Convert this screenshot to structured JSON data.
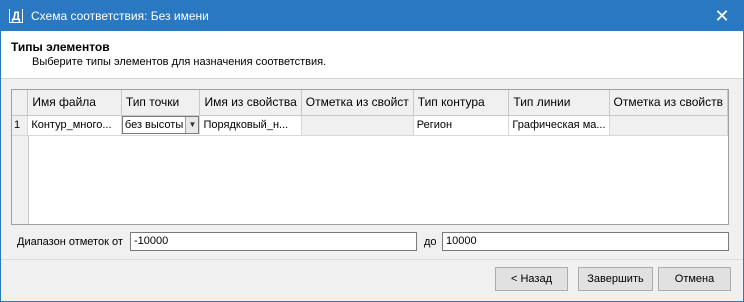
{
  "window": {
    "app_icon": "Д",
    "title": "Схема соответствия: Без имени",
    "close_glyph": "✕"
  },
  "header": {
    "title": "Типы элементов",
    "subtitle": "Выберите типы элементов для назначения соответствия."
  },
  "grid": {
    "columns": [
      "Имя файла",
      "Тип точки",
      "Имя из свойства",
      "Отметка из свойст",
      "Тип контура",
      "Тип линии",
      "Отметка из свойств"
    ],
    "rows": [
      {
        "num": "1",
        "file": "Контур_много...",
        "point_type": "без высоты",
        "name_prop": "Порядковый_н...",
        "elev_prop": "",
        "contour_type": "Регион",
        "line_type": "Графическая ма...",
        "elev_prop2": ""
      }
    ]
  },
  "range": {
    "label": "Диапазон отметок от",
    "from_value": "-10000",
    "to_label": "до",
    "to_value": "10000"
  },
  "buttons": {
    "back": "< Назад",
    "finish": "Завершить",
    "cancel": "Отмена"
  }
}
